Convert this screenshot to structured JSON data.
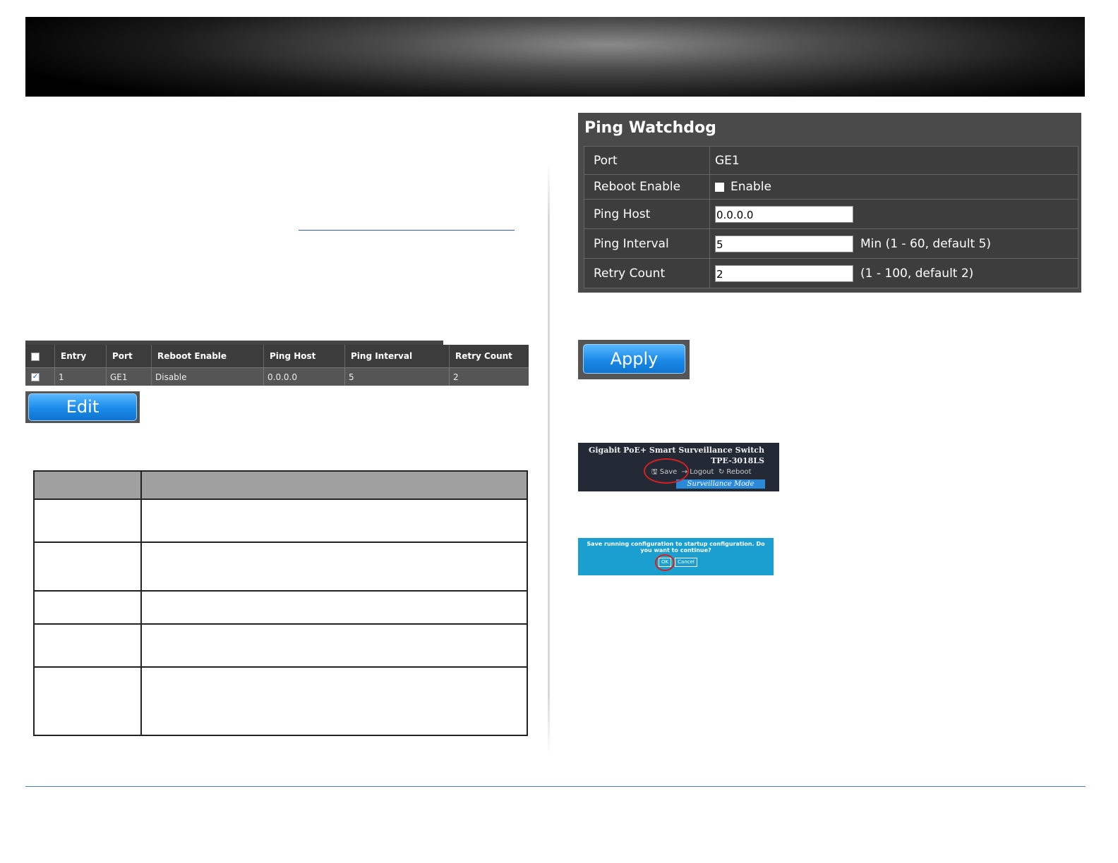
{
  "entry_table": {
    "headers": [
      "Entry",
      "Port",
      "Reboot Enable",
      "Ping Host",
      "Ping Interval",
      "Retry Count"
    ],
    "row": [
      "1",
      "GE1",
      "Disable",
      "0.0.0.0",
      "5",
      "2"
    ]
  },
  "edit_button": "Edit",
  "ping_watchdog": {
    "title": "Ping Watchdog",
    "port_label": "Port",
    "port_value": "GE1",
    "reboot_label": "Reboot Enable",
    "reboot_option": "Enable",
    "host_label": "Ping Host",
    "host_value": "0.0.0.0",
    "interval_label": "Ping Interval",
    "interval_value": "5",
    "interval_hint": "Min (1 - 60, default 5)",
    "retry_label": "Retry Count",
    "retry_value": "2",
    "retry_hint": "(1 - 100, default 2)"
  },
  "apply_button": "Apply",
  "header_shot": {
    "product": "Gigabit PoE+ Smart Surveillance Switch",
    "model": "TPE-3018LS",
    "save": "Save",
    "logout": "Logout",
    "reboot": "Reboot",
    "mode": "Surveillance Mode"
  },
  "save_dialog": {
    "message": "Save running configuration to startup configuration. Do you want to continue?",
    "ok": "OK",
    "cancel": "Cancel"
  },
  "colors": {
    "button_blue": "#1a8ae8",
    "panel_dark": "#4a4a4a",
    "dialog_blue": "#1a9fd0",
    "highlight_red": "#d62020"
  }
}
